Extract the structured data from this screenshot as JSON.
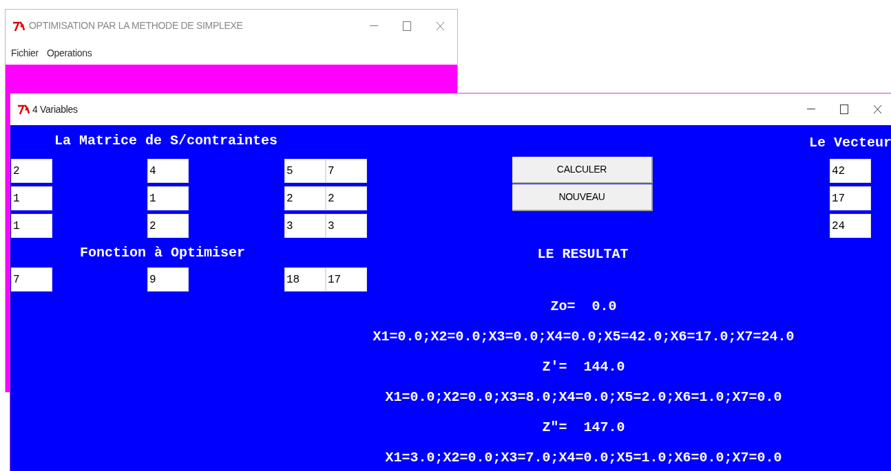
{
  "main_window": {
    "title": "OPTIMISATION PAR LA METHODE DE SIMPLEXE",
    "menu": [
      "Fichier",
      "Operations"
    ]
  },
  "dialog": {
    "title": "4 Variables",
    "matrix_heading": "La Matrice de S/contraintes",
    "matrix": [
      [
        "2",
        "4",
        "5",
        "7"
      ],
      [
        "1",
        "1",
        "2",
        "2"
      ],
      [
        "1",
        "2",
        "3",
        "3"
      ]
    ],
    "objective_heading": "Fonction à Optimiser",
    "objective": [
      "7",
      "9",
      "18",
      "17"
    ],
    "buttons": [
      "CALCULER",
      "NOUVEAU"
    ],
    "result_heading": "LE RESULTAT",
    "results": [
      "Zo=  0.0",
      "X1=0.0;X2=0.0;X3=0.0;X4=0.0;X5=42.0;X6=17.0;X7=24.0",
      "Z'=  144.0",
      "X1=0.0;X2=0.0;X3=8.0;X4=0.0;X5=2.0;X6=1.0;X7=0.0",
      "Z\"=  147.0",
      "X1=3.0;X2=0.0;X3=7.0;X4=0.0;X5=1.0;X6=0.0;X7=0.0"
    ],
    "vector_heading": "Le Vecteur",
    "vector": [
      "42",
      "17",
      "24"
    ]
  }
}
